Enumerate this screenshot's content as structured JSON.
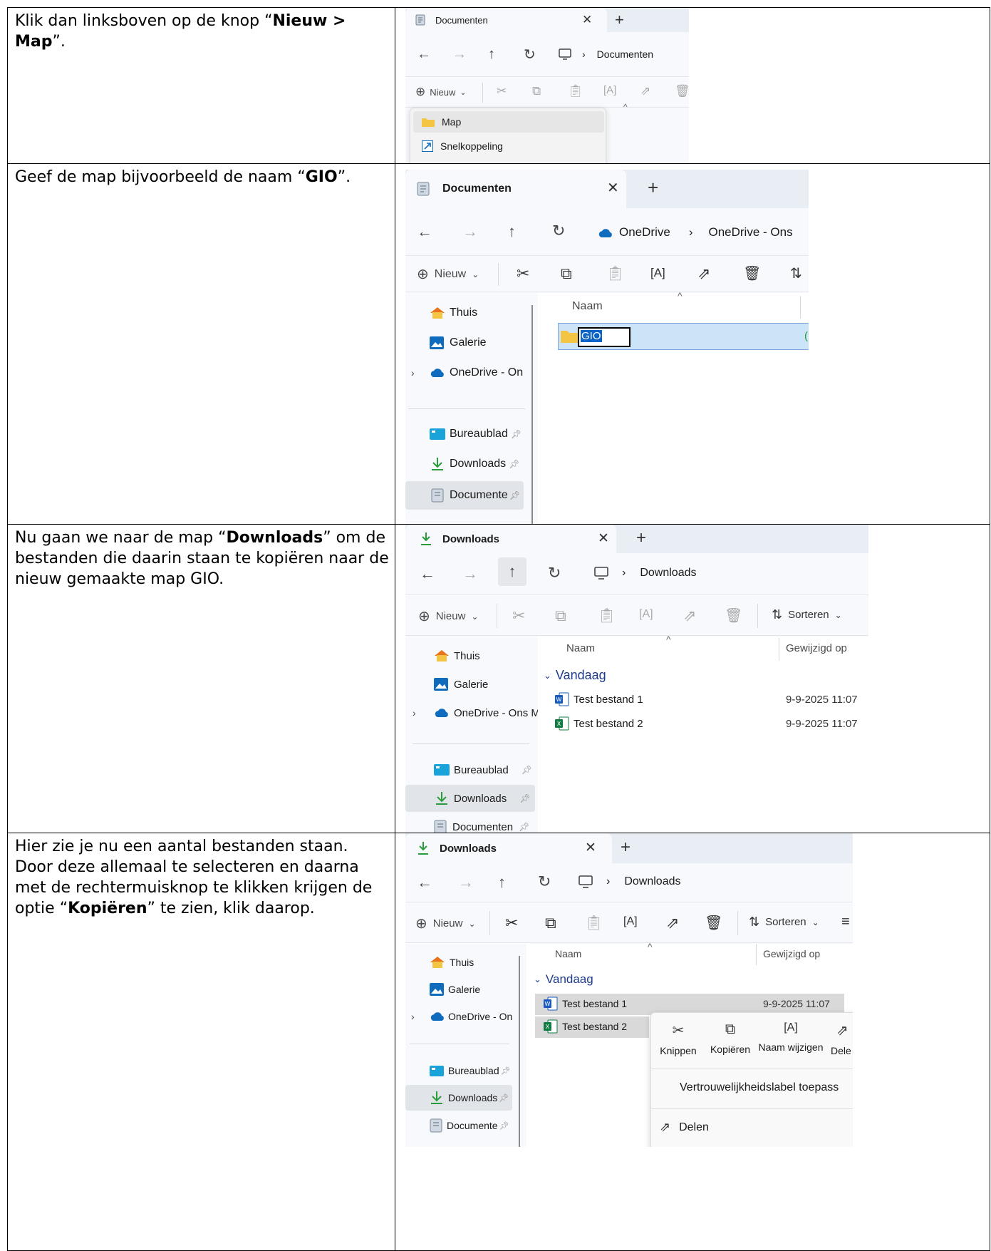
{
  "steps": [
    {
      "parts": [
        {
          "text": "Klik dan linksboven op de knop “",
          "bold": false
        },
        {
          "text": "Nieuw > Map",
          "bold": true
        },
        {
          "text": "”.",
          "bold": false
        }
      ],
      "explorer": {
        "tab_title": "Documenten",
        "address": [
          "Documenten"
        ],
        "new_label": "Nieuw",
        "new_menu": [
          "Map",
          "Snelkoppeling"
        ]
      }
    },
    {
      "parts": [
        {
          "text": "Geef de map bijvoorbeeld de naam “",
          "bold": false
        },
        {
          "text": "GIO",
          "bold": true
        },
        {
          "text": "”.",
          "bold": false
        }
      ],
      "explorer": {
        "tab_title": "Documenten",
        "address": [
          "OneDrive",
          "OneDrive - Ons"
        ],
        "new_label": "Nieuw",
        "nav": [
          "Thuis",
          "Galerie",
          "OneDrive - On",
          "Bureaublad",
          "Downloads",
          "Documente"
        ],
        "column": "Naam",
        "rename_value": "GIO"
      }
    },
    {
      "parts": [
        {
          "text": "Nu gaan we naar de map “",
          "bold": false
        },
        {
          "text": "Downloads",
          "bold": true
        },
        {
          "text": "” om de bestanden die daarin staan te kopiëren naar de nieuw gemaakte map GIO.",
          "bold": false
        }
      ],
      "explorer": {
        "tab_title": "Downloads",
        "address": [
          "Downloads"
        ],
        "new_label": "Nieuw",
        "sort_label": "Sorteren",
        "nav": [
          "Thuis",
          "Galerie",
          "OneDrive - Ons M",
          "Bureaublad",
          "Downloads",
          "Documenten"
        ],
        "columns": [
          "Naam",
          "Gewijzigd op"
        ],
        "group": "Vandaag",
        "files": [
          {
            "name": "Test bestand 1",
            "date": "9-9-2025 11:07",
            "type": "word"
          },
          {
            "name": "Test bestand 2",
            "date": "9-9-2025 11:07",
            "type": "excel"
          }
        ]
      }
    },
    {
      "parts": [
        {
          "text": "Hier zie je nu een aantal bestanden staan. Door deze allemaal te selecteren en daarna met de rechtermuisknop te klikken krijgen de optie “",
          "bold": false
        },
        {
          "text": "Kopiëren",
          "bold": true
        },
        {
          "text": "” te zien, klik daarop.",
          "bold": false
        }
      ],
      "explorer": {
        "tab_title": "Downloads",
        "address": [
          "Downloads"
        ],
        "new_label": "Nieuw",
        "sort_label": "Sorteren",
        "nav": [
          "Thuis",
          "Galerie",
          "OneDrive - On",
          "Bureaublad",
          "Downloads",
          "Documente"
        ],
        "columns": [
          "Naam",
          "Gewijzigd op"
        ],
        "group": "Vandaag",
        "files": [
          {
            "name": "Test bestand 1",
            "date": "9-9-2025 11:07",
            "type": "word"
          },
          {
            "name": "Test bestand 2",
            "date": "",
            "type": "excel"
          }
        ],
        "context_actions": [
          "Knippen",
          "Kopiëren",
          "Naam wijzigen",
          "Dele"
        ],
        "context_items": [
          "Vertrouwelijkheidslabel toepass",
          "Delen"
        ]
      }
    }
  ],
  "colors": {
    "accent": "#0a64c8",
    "selection": "#cce4f7",
    "group_text": "#1f3b8c",
    "folder": "#f4c542",
    "onedrive": "#0f6cbd",
    "word": "#185abd",
    "excel": "#107c41",
    "downloads_arrow": "#2a9d3a"
  }
}
